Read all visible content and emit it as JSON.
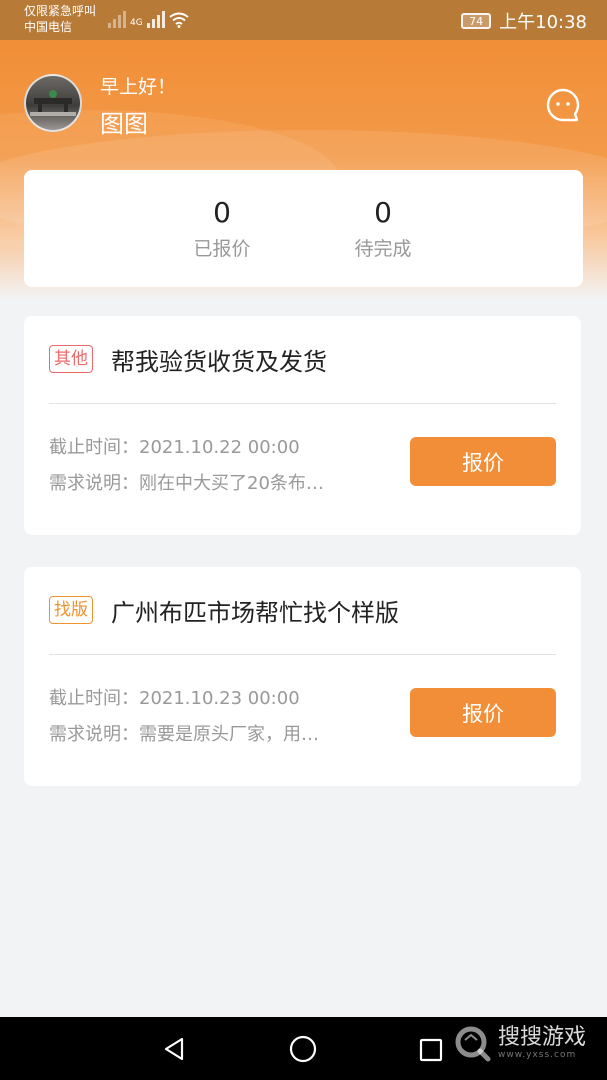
{
  "status_bar": {
    "carrier_line1": "仅限紧急呼叫",
    "carrier_line2": "中国电信",
    "network": "4G",
    "battery": "74",
    "time": "上午10:38"
  },
  "header": {
    "greeting": "早上好！",
    "username": "图图",
    "message_icon": "chat-bubble-icon"
  },
  "stats": [
    {
      "value": "0",
      "label": "已报价"
    },
    {
      "value": "0",
      "label": "待完成"
    }
  ],
  "orders": [
    {
      "tag": "其他",
      "tag_color": "#ee6a6a",
      "title": "帮我验货收货及发货",
      "deadline": "截止时间：2021.10.22 00:00",
      "description": "需求说明：刚在中大买了20条布…",
      "action": "报价"
    },
    {
      "tag": "找版",
      "tag_color": "#ef9331",
      "title": "广州布匹市场帮忙找个样版",
      "deadline": "截止时间：2021.10.23 00:00",
      "description": "需求说明：需要是原头厂家，用…",
      "action": "报价"
    }
  ],
  "nav_bar": {
    "watermark_text": "搜搜游戏",
    "watermark_url": "www.yxss.com"
  },
  "colors": {
    "accent": "#f18e37",
    "background": "#f2f3f5"
  }
}
